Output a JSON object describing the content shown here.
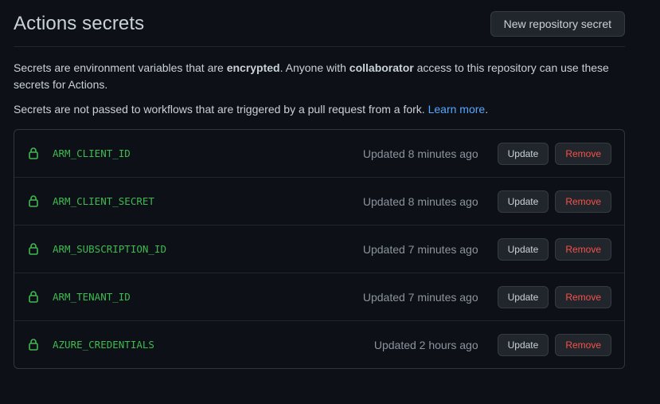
{
  "header": {
    "title": "Actions secrets",
    "new_button_label": "New repository secret"
  },
  "description": {
    "p1_part1": "Secrets are environment variables that are ",
    "p1_bold1": "encrypted",
    "p1_part2": ". Anyone with ",
    "p1_bold2": "collaborator",
    "p1_part3": " access to this repository can use these secrets for Actions.",
    "p2_text": "Secrets are not passed to workflows that are triggered by a pull request from a fork. ",
    "p2_link": "Learn more",
    "p2_end": "."
  },
  "secrets": [
    {
      "name": "ARM_CLIENT_ID",
      "updated": "Updated 8 minutes ago",
      "update_label": "Update",
      "remove_label": "Remove"
    },
    {
      "name": "ARM_CLIENT_SECRET",
      "updated": "Updated 8 minutes ago",
      "update_label": "Update",
      "remove_label": "Remove"
    },
    {
      "name": "ARM_SUBSCRIPTION_ID",
      "updated": "Updated 7 minutes ago",
      "update_label": "Update",
      "remove_label": "Remove"
    },
    {
      "name": "ARM_TENANT_ID",
      "updated": "Updated 7 minutes ago",
      "update_label": "Update",
      "remove_label": "Remove"
    },
    {
      "name": "AZURE_CREDENTIALS",
      "updated": "Updated 2 hours ago",
      "update_label": "Update",
      "remove_label": "Remove"
    }
  ],
  "icons": {
    "secret_icon": "lock-icon"
  },
  "colors": {
    "background": "#0d1117",
    "secret_name": "#3fb950",
    "link": "#58a6ff",
    "danger": "#f85149",
    "muted": "#8b949e"
  }
}
